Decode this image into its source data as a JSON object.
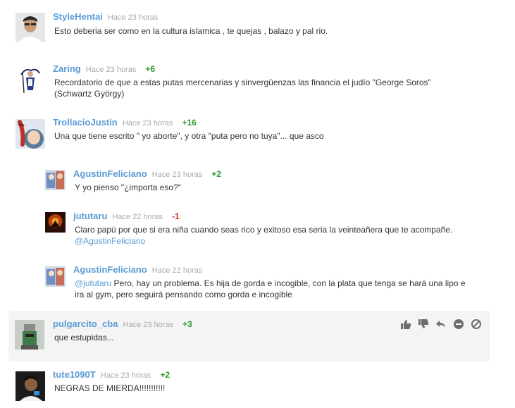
{
  "comments": [
    {
      "user": "StyleHentai",
      "time": "Hace 23 horas",
      "score": "",
      "text": "Esto deberia ser como en la cultura islamica , te quejas , balazo y pal rio."
    },
    {
      "user": "Zaring",
      "time": "Hace 23 horas",
      "score": "+6",
      "text_line1": "Recordatorio de que a estas putas mercenarias y sinvergüenzas las financia el judío \"George Soros\"",
      "text_line2": "(Schwartz György)"
    },
    {
      "user": "TrollacioJustin",
      "time": "Hace 23 horas",
      "score": "+16",
      "text": "Una que tiene escrito \" yo aborte\", y otra \"puta pero no tuya\"... que asco"
    },
    {
      "user": "AgustinFeliciano",
      "time": "Hace 23 horas",
      "score": "+2",
      "text": "Y yo pienso \"¿importa eso?\""
    },
    {
      "user": "jututaru",
      "time": "Hace 22 horas",
      "score": "-1",
      "text": "Claro papú por que si era niña cuando seas rico y exitoso esa seria la veinteañera que te acompañe.",
      "mention": "@AgustinFeliciano"
    },
    {
      "user": "AgustinFeliciano",
      "time": "Hace 22 horas",
      "score": "",
      "mention": "@jututaru",
      "text_line1": " Pero, hay un problema. Es hija de gorda e incogible, con la plata que tenga se hará una lipo e",
      "text_line2": "ira al gym, pero seguirá pensando como gorda e incogible"
    },
    {
      "user": "pulgarcito_cba",
      "time": "Hace 23 horas",
      "score": "+3",
      "text": "que estupidas..."
    },
    {
      "user": "tute1090T",
      "time": "Hace 23 horas",
      "score": "+2",
      "text": "NEGRAS DE MIERDA!!!!!!!!!!!"
    }
  ],
  "colors": {
    "username": "#5b9bd5",
    "time": "#a9a9a9",
    "positive": "#2e9b2e",
    "negative": "#d62b1f",
    "hover_bg": "#f4f4f4",
    "icons": "#6e6e6e"
  },
  "action_icons": [
    "thumbs-up-icon",
    "thumbs-down-icon",
    "reply-icon",
    "hide-icon",
    "report-icon"
  ]
}
